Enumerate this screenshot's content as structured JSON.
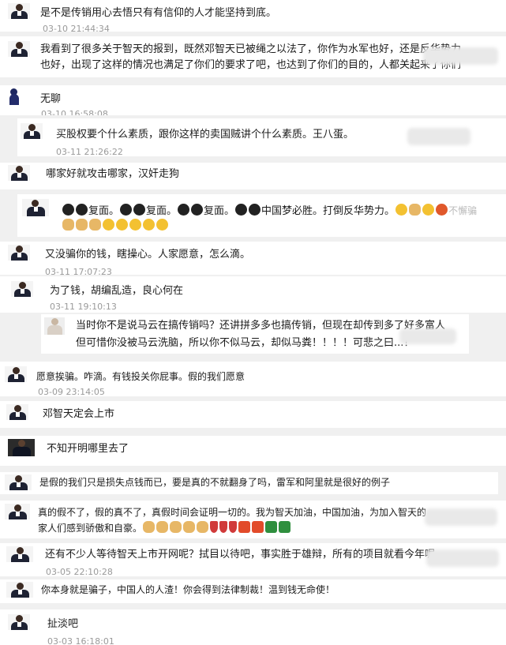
{
  "comments": [
    {
      "text": "是不是传销用心去悟只有有信仰的人才能坚持到底。",
      "time": "03-10 21:44:34"
    },
    {
      "lines": [
        "我看到了很多关于智天的报到，既然邓智天已被绳之以法了，你作为水军也好，还是反华势力",
        "也好，出现了这样的情况也满足了你们的要求了吧，也达到了你们的目的，人都关起来了你们"
      ]
    },
    {
      "text": "无聊",
      "time": "03-10 16:58:08"
    },
    {
      "text": "买股权要个什么素质，跟你这样的卖国贼讲个什么素质。王八蛋。",
      "time": "03-11 21:26:22"
    },
    {
      "text": "哪家好就攻击哪家，汉奸走狗"
    },
    {
      "text": "复面。",
      "items": [
        "复面。",
        "复面。",
        "复面。",
        "中国梦必胜。打倒反华势力。"
      ],
      "tail": "不懈骗"
    },
    {
      "text": "又没骗你的钱，瞎操心。人家愿意，怎么滴。",
      "time": "03-11 17:07:23"
    },
    {
      "text": "为了钱，胡编乱造，良心何在",
      "time": "03-11 19:10:13"
    },
    {
      "lines": [
        "当时你不是说马云在搞传销吗？还讲拼多多也搞传销，但现在却传到多了好多富人",
        "但可惜你没被马云洗脑，所以你不似马云，却似马粪！！！！可悲之曰...！"
      ]
    },
    {
      "text": "愿意挨骗。咋滴。有钱投关你屁事。假的我们愿意",
      "time": "03-09 23:14:05"
    },
    {
      "text": "邓智天定会上市"
    },
    {
      "text": "不知开明哪里去了"
    },
    {
      "text": "是假的我们只是损失点钱而已，要是真的不就翻身了吗，雷军和阿里就是很好的例子"
    },
    {
      "lines": [
        "真的假不了，假的真不了，真假时间会证明一切的。我为智天加油，中国加油，为加入智天的",
        "家人们感到骄傲和自豪。"
      ]
    },
    {
      "text": "还有不少人等待智天上市开网呢？拭目以待吧，事实胜于雄辩，所有的项目就看今年呢",
      "time": "03-05 22:10:28"
    },
    {
      "text": "你本身就是骗子，中国人的人渣！你会得到法律制裁！温到钱无命使！"
    },
    {
      "text": "扯淡吧",
      "time": "03-03 16:18:01"
    }
  ]
}
